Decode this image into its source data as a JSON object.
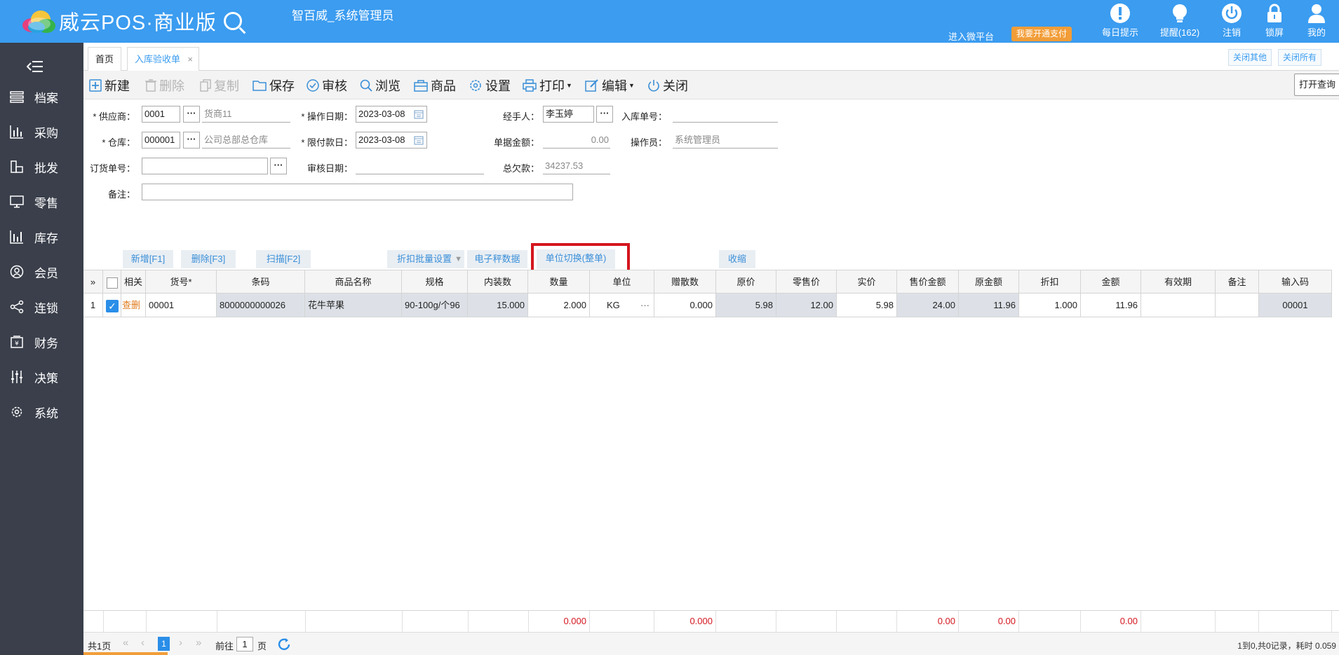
{
  "header": {
    "logo_text": "威云POS·商业版",
    "user_name": "智百威_系统管理员",
    "enter_wei": "进入微平台",
    "pay_label": "我要开通支付",
    "actions": [
      {
        "label": "每日提示",
        "icon": "exclamation-icon"
      },
      {
        "label": "提醒(162)",
        "icon": "bulb-icon"
      },
      {
        "label": "注销",
        "icon": "power-icon"
      },
      {
        "label": "锁屏",
        "icon": "lock-icon"
      },
      {
        "label": "我的",
        "icon": "user-icon"
      }
    ]
  },
  "sidebar": {
    "items": [
      {
        "label": "档案",
        "icon": "layers-icon"
      },
      {
        "label": "采购",
        "icon": "bar-chart-icon"
      },
      {
        "label": "批发",
        "icon": "blocks-icon"
      },
      {
        "label": "零售",
        "icon": "monitor-icon"
      },
      {
        "label": "库存",
        "icon": "stock-chart-icon"
      },
      {
        "label": "会员",
        "icon": "member-icon"
      },
      {
        "label": "连锁",
        "icon": "share-icon"
      },
      {
        "label": "财务",
        "icon": "finance-icon"
      },
      {
        "label": "决策",
        "icon": "sliders-icon"
      },
      {
        "label": "系统",
        "icon": "gear-icon"
      }
    ]
  },
  "tabs": {
    "home": "首页",
    "receipt": "入库验收单",
    "close_others": "关闭其他",
    "close_all": "关闭所有"
  },
  "toolbar": {
    "new": "新建",
    "delete": "删除",
    "copy": "复制",
    "save": "保存",
    "audit": "审核",
    "browse": "浏览",
    "goods": "商品",
    "settings": "设置",
    "print": "打印",
    "edit": "编辑",
    "close": "关闭",
    "open_query": "打开查询"
  },
  "form": {
    "supplier_label": "* 供应商：",
    "supplier_code": "0001",
    "supplier_name": "货商11",
    "op_date_label": "* 操作日期：",
    "op_date": "2023-03-08",
    "handler_label": "经手人：",
    "handler": "李玉婷",
    "in_no_label": "入库单号：",
    "in_no": "",
    "warehouse_label": "* 仓库：",
    "warehouse_code": "000001",
    "warehouse_name": "公司总部总仓库",
    "due_date_label": "* 限付款日：",
    "due_date": "2023-03-08",
    "amount_label": "单据金额：",
    "amount": "0.00",
    "operator_label": "操作员：",
    "operator": "系统管理员",
    "order_no_label": "订货单号：",
    "order_no": "",
    "audit_date_label": "审核日期：",
    "audit_date": "",
    "total_owed_label": "总欠款：",
    "total_owed": "34237.53",
    "remark_label": "备注：",
    "remark": ""
  },
  "action_buttons": {
    "add": "新增[F1]",
    "del": "删除[F3]",
    "scan": "扫描[F2]",
    "discount": "折扣批量设置",
    "scale": "电子秤数据",
    "unit_switch": "单位切换(整单)",
    "collapse": "收缩"
  },
  "table": {
    "columns": [
      "相关",
      "货号*",
      "条码",
      "商品名称",
      "规格",
      "内装数",
      "数量",
      "单位",
      "赠散数",
      "原价",
      "零售价",
      "实价",
      "售价金额",
      "原金额",
      "折扣",
      "金额",
      "有效期",
      "备注",
      "输入码"
    ],
    "rows": [
      {
        "idx": "1",
        "check": "查",
        "del": "删",
        "code": "00001",
        "barcode": "8000000000026",
        "name": "花牛苹果",
        "spec": "90-100g/个96",
        "pack": "15.000",
        "qty": "2.000",
        "unit": "KG",
        "unit_more": "···",
        "gift": "0.000",
        "orig_price": "5.98",
        "retail": "12.00",
        "real": "5.98",
        "sale_amt": "24.00",
        "orig_amt": "11.96",
        "discount": "1.000",
        "amount": "11.96",
        "expiry": "",
        "remark": "",
        "input_code": "00001"
      }
    ],
    "footer": {
      "qty": "0.000",
      "gift": "0.000",
      "sale_amt": "0.00",
      "orig_amt": "0.00",
      "amount": "0.00"
    }
  },
  "pager": {
    "total_pages": "共1页",
    "current": "1",
    "goto_label": "前往",
    "goto_value": "1",
    "page_suffix": "页",
    "summary": "1到0,共0记录，耗时 0.059"
  },
  "colors": {
    "topbar": "#3b9cf0",
    "sidebar": "#3a3f4b",
    "highlight": "#d4161f",
    "pay": "#f29d38"
  }
}
